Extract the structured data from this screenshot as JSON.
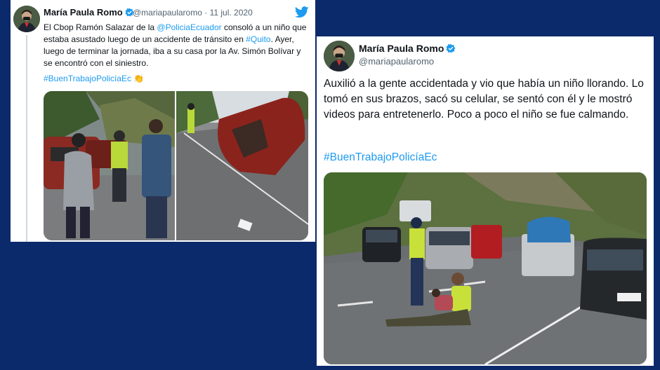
{
  "tweet1": {
    "name": "María Paula Romo",
    "handle": "@mariapaularomo",
    "separator": "·",
    "date": "11 jul. 2020",
    "text_part1": "El Cbop Ramón Salazar de la ",
    "mention": "@PoliciaEcuador",
    "text_part2": " consoló a un niño que estaba asustado luego de un accidente de tránsito en ",
    "hashtag_place": "#Quito",
    "text_part3": ". Ayer, luego de terminar la jornada, iba a su casa por la Av. Simón Bolívar y se encontró con el siniestro.",
    "hashtag": "#BuenTrabajoPolicíaEc",
    "emoji": "👏",
    "icons": [
      "verified-badge-icon",
      "twitter-bird-icon"
    ]
  },
  "tweet2": {
    "name": "María Paula Romo",
    "handle": "@mariapaularomo",
    "text": "Auxilió a la gente accidentada y vio que había un niño llorando. Lo tomó en sus brazos, sacó su celular, se sentó con él y le mostró videos para entretenerlo. Poco a poco el niño se fue calmando.",
    "hashtag": "#BuenTrabajoPolicíaEc",
    "icons": [
      "verified-badge-icon"
    ]
  },
  "colors": {
    "background": "#0b2a6b",
    "link": "#1d9bf0",
    "text": "#0f1419",
    "secondary": "#536471",
    "verified": "#1d9bf0"
  }
}
